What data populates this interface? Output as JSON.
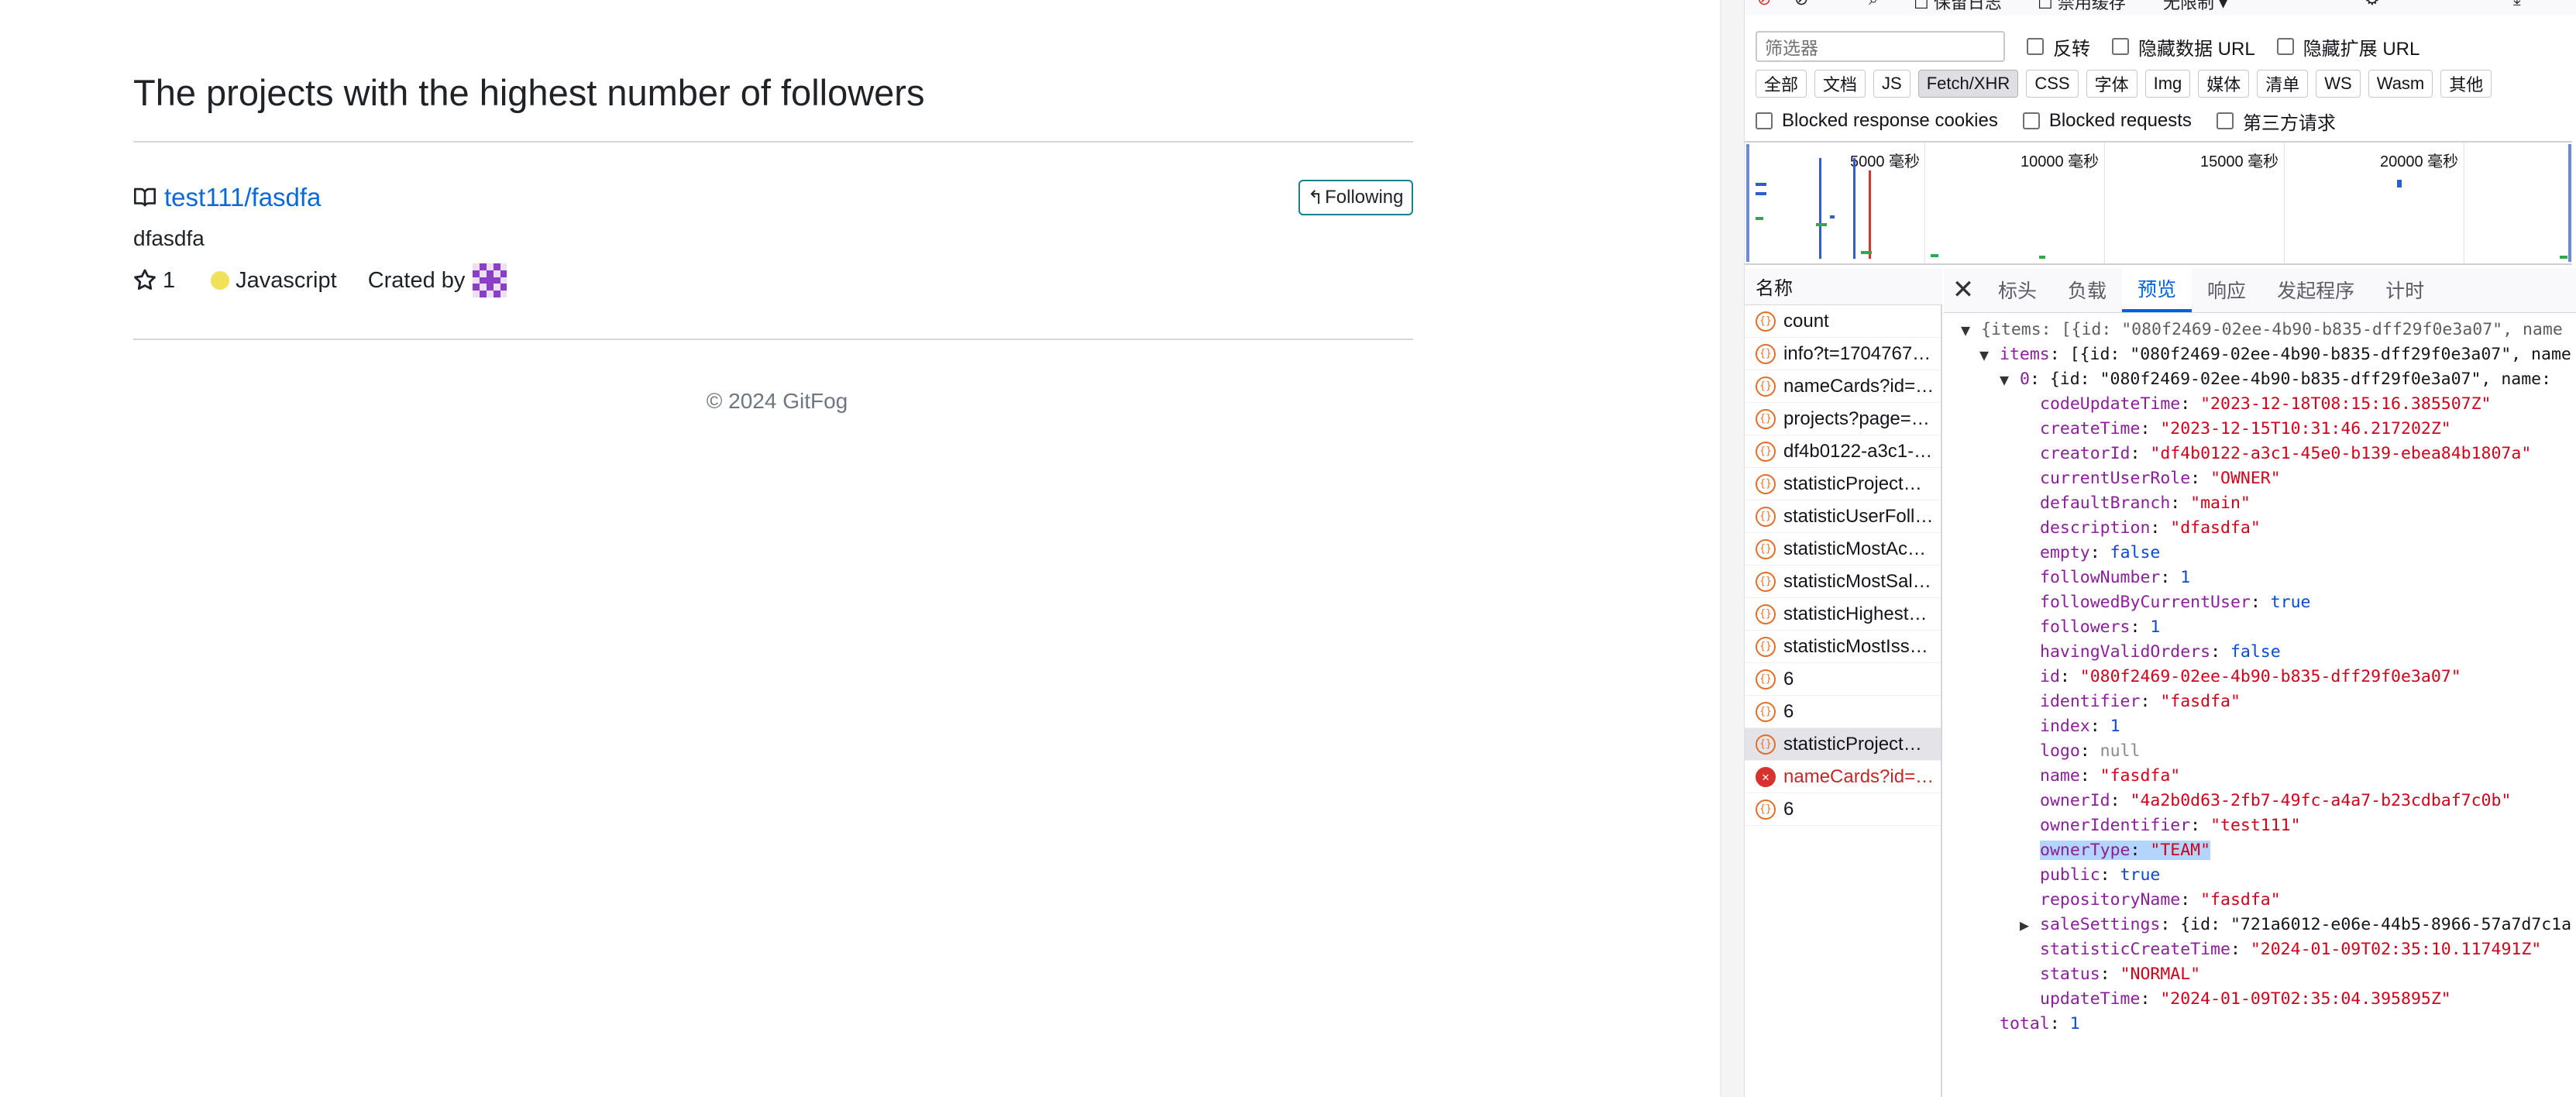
{
  "page": {
    "heading": "The projects with the highest number of followers",
    "repo": {
      "link_text": "test111/fasdfa",
      "description": "dfasdfa",
      "stars": "1",
      "language": "Javascript",
      "created_by_label": "Crated by",
      "follow_button_label": "Following"
    },
    "footer": "© 2024 GitFog",
    "colors": {
      "link": "#0969da",
      "language_dot": "#f1e05a",
      "follow_border": "#1a7f8e"
    }
  },
  "devtools": {
    "top_partial": [
      "保留日志",
      "禁用缓存",
      "无限制"
    ],
    "filter_placeholder": "筛选器",
    "filter_checkboxes": [
      "反转",
      "隐藏数据 URL",
      "隐藏扩展 URL"
    ],
    "type_buttons": [
      "全部",
      "文档",
      "JS",
      "Fetch/XHR",
      "CSS",
      "字体",
      "Img",
      "媒体",
      "清单",
      "WS",
      "Wasm",
      "其他"
    ],
    "active_type": "Fetch/XHR",
    "blocked_checkboxes": [
      "Blocked response cookies",
      "Blocked requests",
      "第三方请求"
    ],
    "timeline_labels": [
      "5000 毫秒",
      "10000 毫秒",
      "15000 毫秒",
      "20000 毫秒"
    ],
    "list_header": "名称",
    "requests": [
      {
        "name": "count",
        "state": "normal"
      },
      {
        "name": "info?t=1704767…",
        "state": "normal"
      },
      {
        "name": "nameCards?id=…",
        "state": "normal"
      },
      {
        "name": "projects?page=…",
        "state": "normal"
      },
      {
        "name": "df4b0122-a3c1-…",
        "state": "normal"
      },
      {
        "name": "statisticProject…",
        "state": "normal"
      },
      {
        "name": "statisticUserFoll…",
        "state": "normal"
      },
      {
        "name": "statisticMostAc…",
        "state": "normal"
      },
      {
        "name": "statisticMostSal…",
        "state": "normal"
      },
      {
        "name": "statisticHighest…",
        "state": "normal"
      },
      {
        "name": "statisticMostIss…",
        "state": "normal"
      },
      {
        "name": "6",
        "state": "normal"
      },
      {
        "name": "6",
        "state": "normal"
      },
      {
        "name": "statisticProject…",
        "state": "selected"
      },
      {
        "name": "nameCards?id=…",
        "state": "error"
      },
      {
        "name": "6",
        "state": "normal"
      }
    ],
    "detail_tabs": [
      "标头",
      "负载",
      "预览",
      "响应",
      "发起程序",
      "计时"
    ],
    "active_detail_tab": "预览",
    "json_preview": {
      "root_summary": "{items: [{id: \"080f2469-02ee-4b90-b835-dff29f0e3a07\", name",
      "items_summary": "items: [{id: \"080f2469-02ee-4b90-b835-dff29f0e3a07\", name",
      "item0_summary": "0: {id: \"080f2469-02ee-4b90-b835-dff29f0e3a07\", name:",
      "fields": [
        {
          "key": "codeUpdateTime",
          "value": "\"2023-12-18T08:15:16.385507Z\"",
          "type": "s"
        },
        {
          "key": "createTime",
          "value": "\"2023-12-15T10:31:46.217202Z\"",
          "type": "s"
        },
        {
          "key": "creatorId",
          "value": "\"df4b0122-a3c1-45e0-b139-ebea84b1807a\"",
          "type": "s"
        },
        {
          "key": "currentUserRole",
          "value": "\"OWNER\"",
          "type": "s"
        },
        {
          "key": "defaultBranch",
          "value": "\"main\"",
          "type": "s"
        },
        {
          "key": "description",
          "value": "\"dfasdfa\"",
          "type": "s"
        },
        {
          "key": "empty",
          "value": "false",
          "type": "b"
        },
        {
          "key": "followNumber",
          "value": "1",
          "type": "n"
        },
        {
          "key": "followedByCurrentUser",
          "value": "true",
          "type": "b"
        },
        {
          "key": "followers",
          "value": "1",
          "type": "n"
        },
        {
          "key": "havingValidOrders",
          "value": "false",
          "type": "b"
        },
        {
          "key": "id",
          "value": "\"080f2469-02ee-4b90-b835-dff29f0e3a07\"",
          "type": "s"
        },
        {
          "key": "identifier",
          "value": "\"fasdfa\"",
          "type": "s"
        },
        {
          "key": "index",
          "value": "1",
          "type": "n"
        },
        {
          "key": "logo",
          "value": "null",
          "type": "nul"
        },
        {
          "key": "name",
          "value": "\"fasdfa\"",
          "type": "s"
        },
        {
          "key": "ownerId",
          "value": "\"4a2b0d63-2fb7-49fc-a4a7-b23cdbaf7c0b\"",
          "type": "s"
        },
        {
          "key": "ownerIdentifier",
          "value": "\"test111\"",
          "type": "s"
        },
        {
          "key": "ownerType",
          "value": "\"TEAM\"",
          "type": "s",
          "highlight": true
        },
        {
          "key": "public",
          "value": "true",
          "type": "b"
        },
        {
          "key": "repositoryName",
          "value": "\"fasdfa\"",
          "type": "s"
        },
        {
          "key": "saleSettings",
          "value": "{id: \"721a6012-e06e-44b5-8966-57a7d7c1a",
          "type": "obj",
          "collapsed": true
        },
        {
          "key": "statisticCreateTime",
          "value": "\"2024-01-09T02:35:10.117491Z\"",
          "type": "s"
        },
        {
          "key": "status",
          "value": "\"NORMAL\"",
          "type": "s"
        },
        {
          "key": "updateTime",
          "value": "\"2024-01-09T02:35:04.395895Z\"",
          "type": "s"
        }
      ],
      "total": {
        "key": "total",
        "value": "1"
      }
    }
  }
}
